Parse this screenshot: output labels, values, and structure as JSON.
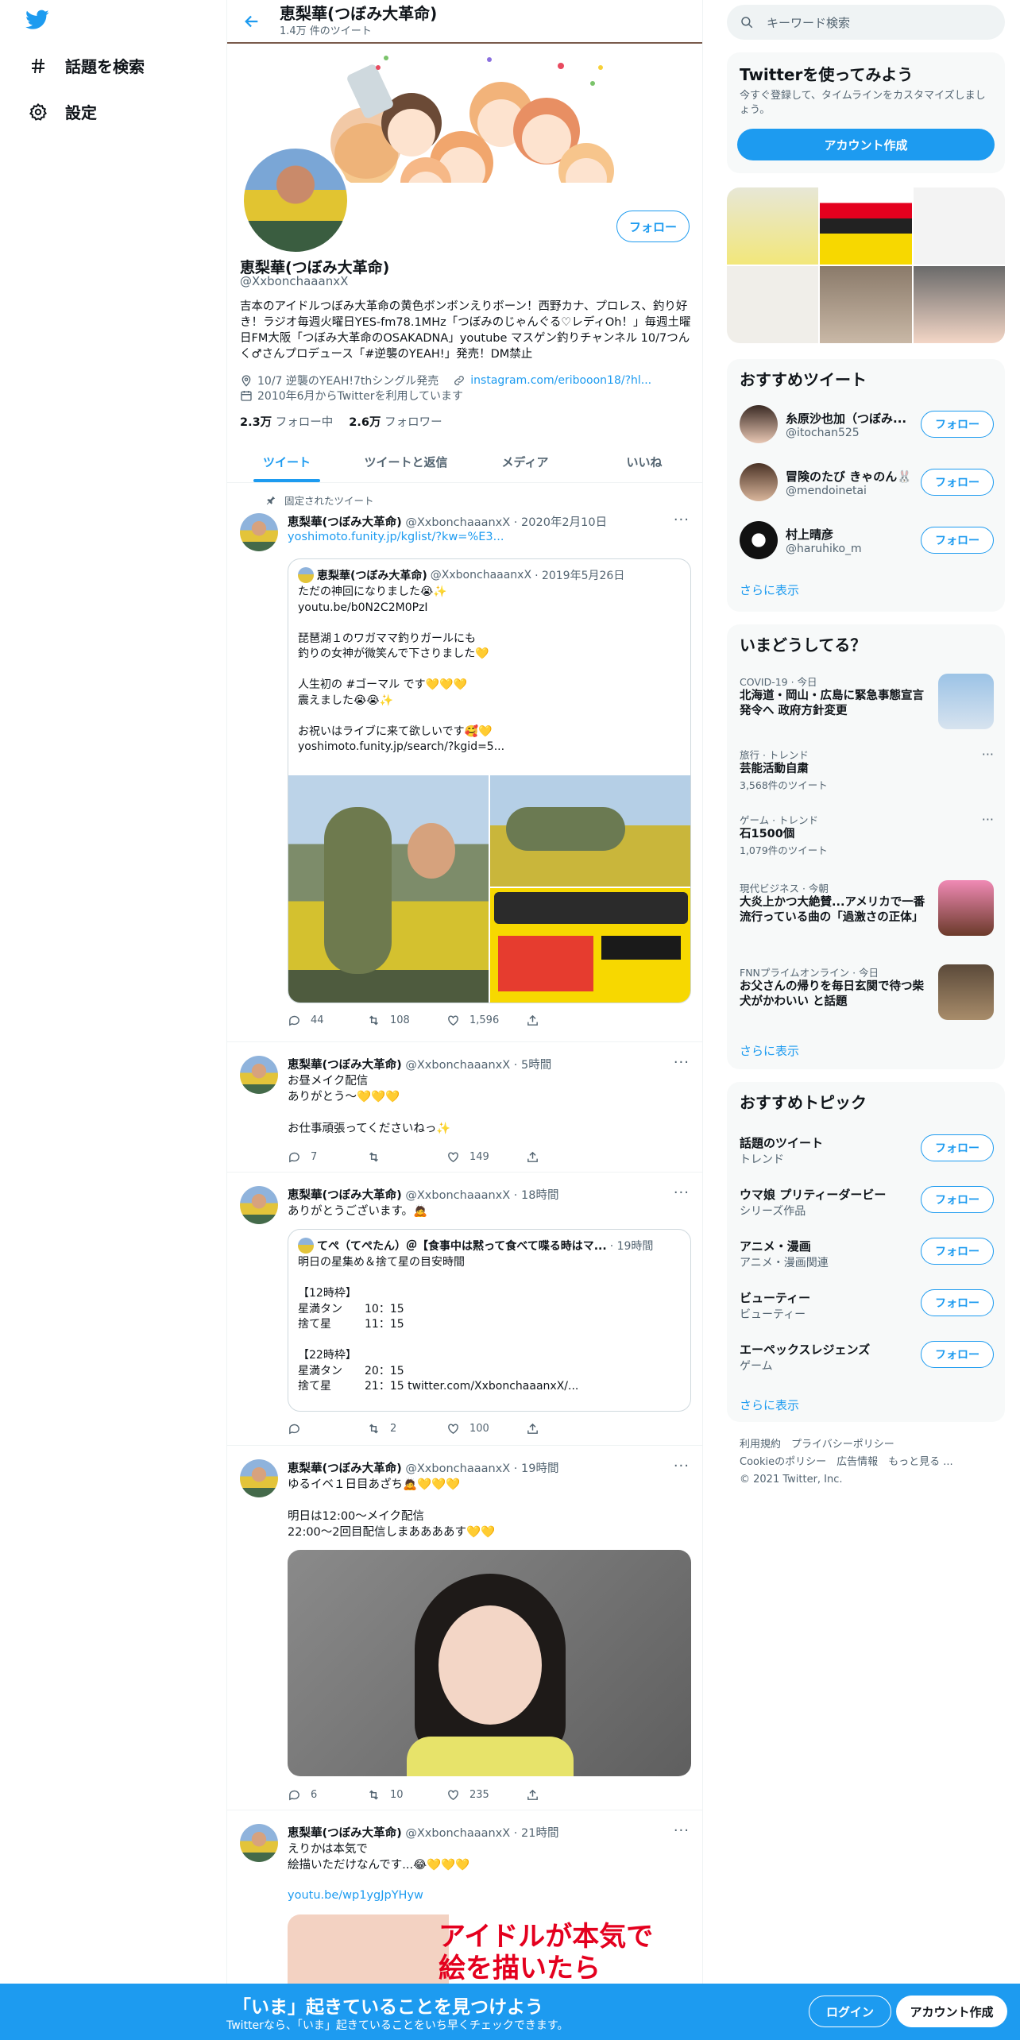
{
  "colors": {
    "accent": "#1d9bf0",
    "text": "#0f1419",
    "muted": "#536471",
    "card_bg": "#f7f9f9",
    "divider": "#eff3f4"
  },
  "nav": {
    "logo_icon": "twitter-bird-icon",
    "items": [
      {
        "label": "話題を検索",
        "icon": "hashtag-icon"
      },
      {
        "label": "設定",
        "icon": "gear-icon"
      }
    ]
  },
  "header": {
    "name": "恵梨華(つぼみ大革命)",
    "tweet_count": "1.4万 件のツイート"
  },
  "profile": {
    "name": "恵梨華(つぼみ大革命)",
    "handle": "@XxbonchaaanxX",
    "follow_label": "フォロー",
    "bio": "吉本のアイドルつぼみ大革命の黄色ボンボンえりボーン！西野カナ、プロレス、釣り好き！ラジオ毎週火曜日YES-fm78.1MHz「つぼみのじゃんぐる♡レディOh！」毎週土曜日FM大阪「つぼみ大革命のOSAKADNA」youtube マスゲン釣りチャンネル 10/7つんく♂さんプロデュース「#逆襲のYEAH!」発売！DM禁止",
    "location": "10/7 逆襲のYEAH!7thシングル発売",
    "website": "instagram.com/eribooon18/?hl...",
    "joined": "2010年6月からTwitterを利用しています",
    "following_count": "2.3万",
    "following_label": "フォロー中",
    "followers_count": "2.6万",
    "followers_label": "フォロワー"
  },
  "tabs": [
    "ツイート",
    "ツイートと返信",
    "メディア",
    "いいね"
  ],
  "pinned_label": "固定されたツイート",
  "tweets": [
    {
      "name": "恵梨華(つぼみ大革命)",
      "handle": "@XxbonchaaanxX",
      "time": "· 2020年2月10日",
      "link": "yoshimoto.funity.jp/kglist/?kw=%E3...",
      "quote": {
        "name": "恵梨華(つぼみ大革命)",
        "handle": "@XxbonchaaanxX",
        "time": "· 2019年5月26日",
        "text": "ただの神回になりました😭✨\nyoutu.be/b0N2C2M0PzI\n\n琵琶湖１のワガママ釣りガールにも\n釣りの女神が微笑んで下さりました💛\n\n人生初の #ゴーマル です💛💛💛\n震えました😭😭✨\n\nお祝いはライブに来て欲しいです🥰💛\nyoshimoto.funity.jp/search/?kgid=5..."
      },
      "replies": "44",
      "retweets": "108",
      "likes": "1,596"
    },
    {
      "name": "恵梨華(つぼみ大革命)",
      "handle": "@XxbonchaaanxX",
      "time": "· 5時間",
      "text": "お昼メイク配信\nありがとう〜💛💛💛\n\nお仕事頑張ってくださいねっ✨",
      "replies": "7",
      "retweets": "",
      "likes": "149"
    },
    {
      "name": "恵梨華(つぼみ大革命)",
      "handle": "@XxbonchaaanxX",
      "time": "· 18時間",
      "text": "ありがとうございます。🙇",
      "quote": {
        "name": "てぺ（てぺたん）＠【食事中は黙って食べて喋る時はマ...",
        "handle": "",
        "time": "· 19時間",
        "text": "明日の星集め＆捨て星の目安時間\n\n【12時枠】\n星満タン　　10：15\n捨て星　　　11：15\n\n【22時枠】\n星満タン　　20：15\n捨て星　　　21：15 twitter.com/XxbonchaaanxX/..."
      },
      "replies": "",
      "retweets": "2",
      "likes": "100"
    },
    {
      "name": "恵梨華(つぼみ大革命)",
      "handle": "@XxbonchaaanxX",
      "time": "· 19時間",
      "text": "ゆるイベ１日目あざち🙇💛💛💛\n\n明日は12:00〜メイク配信\n22:00〜2回目配信しまああああす💛💛",
      "replies": "6",
      "retweets": "10",
      "likes": "235"
    },
    {
      "name": "恵梨華(つぼみ大革命)",
      "handle": "@XxbonchaaanxX",
      "time": "· 21時間",
      "text": "えりかは本気で\n絵描いただけなんです...😂💛💛💛",
      "link": "youtu.be/wp1ygJpYHyw",
      "thumb_text": "アイドルが本気で\n絵を描いたら"
    }
  ],
  "search": {
    "placeholder": "キーワード検索"
  },
  "signup_card": {
    "title": "Twitterを使ってみよう",
    "text": "今すぐ登録して、タイムラインをカスタマイズしましょう。",
    "button": "アカウント作成"
  },
  "who_to_follow": {
    "title": "おすすめツイート",
    "users": [
      {
        "name": "糸原沙也加（つぼみ...",
        "handle": "@itochan525",
        "button": "フォロー"
      },
      {
        "name": "冒険のたび きゃのん🐰",
        "handle": "@mendoinetai",
        "button": "フォロー"
      },
      {
        "name": "村上晴彦",
        "handle": "@haruhiko_m",
        "button": "フォロー"
      }
    ],
    "show_more": "さらに表示"
  },
  "trends": {
    "title": "いまどうしてる？",
    "items": [
      {
        "context": "COVID-19 · 今日",
        "title": "北海道・岡山・広島に緊急事態宣言発令へ 政府方針変更",
        "count": ""
      },
      {
        "context": "旅行 · トレンド",
        "title": "芸能活動自粛",
        "count": "3,568件のツイート"
      },
      {
        "context": "ゲーム · トレンド",
        "title": "石1500個",
        "count": "1,079件のツイート"
      },
      {
        "context": "現代ビジネス · 今朝",
        "title": "大炎上かつ大絶賛...アメリカで一番流行っている曲の「過激さの正体」",
        "count": ""
      },
      {
        "context": "FNNプライムオンライン · 今日",
        "title": "お父さんの帰りを毎日玄関で待つ柴犬がかわいい と話題",
        "count": ""
      }
    ],
    "show_more": "さらに表示"
  },
  "topics": {
    "title": "おすすめトピック",
    "items": [
      {
        "title": "話題のツイート",
        "sub": "トレンド",
        "button": "フォロー"
      },
      {
        "title": "ウマ娘 プリティーダービー",
        "sub": "シリーズ作品",
        "button": "フォロー"
      },
      {
        "title": "アニメ・漫画",
        "sub": "アニメ・漫画関連",
        "button": "フォロー"
      },
      {
        "title": "ビューティー",
        "sub": "ビューティー",
        "button": "フォロー"
      },
      {
        "title": "エーペックスレジェンズ",
        "sub": "ゲーム",
        "button": "フォロー"
      }
    ],
    "show_more": "さらに表示"
  },
  "footer": {
    "line1": "利用規約　プライバシーポリシー",
    "line2": "Cookieのポリシー　広告情報　もっと見る ...",
    "line3": "© 2021 Twitter, Inc."
  },
  "bottom_bar": {
    "title": "「いま」起きていることを見つけよう",
    "subtitle": "Twitterなら、「いま」起きていることをいち早くチェックできます。",
    "login": "ログイン",
    "signup": "アカウント作成"
  }
}
